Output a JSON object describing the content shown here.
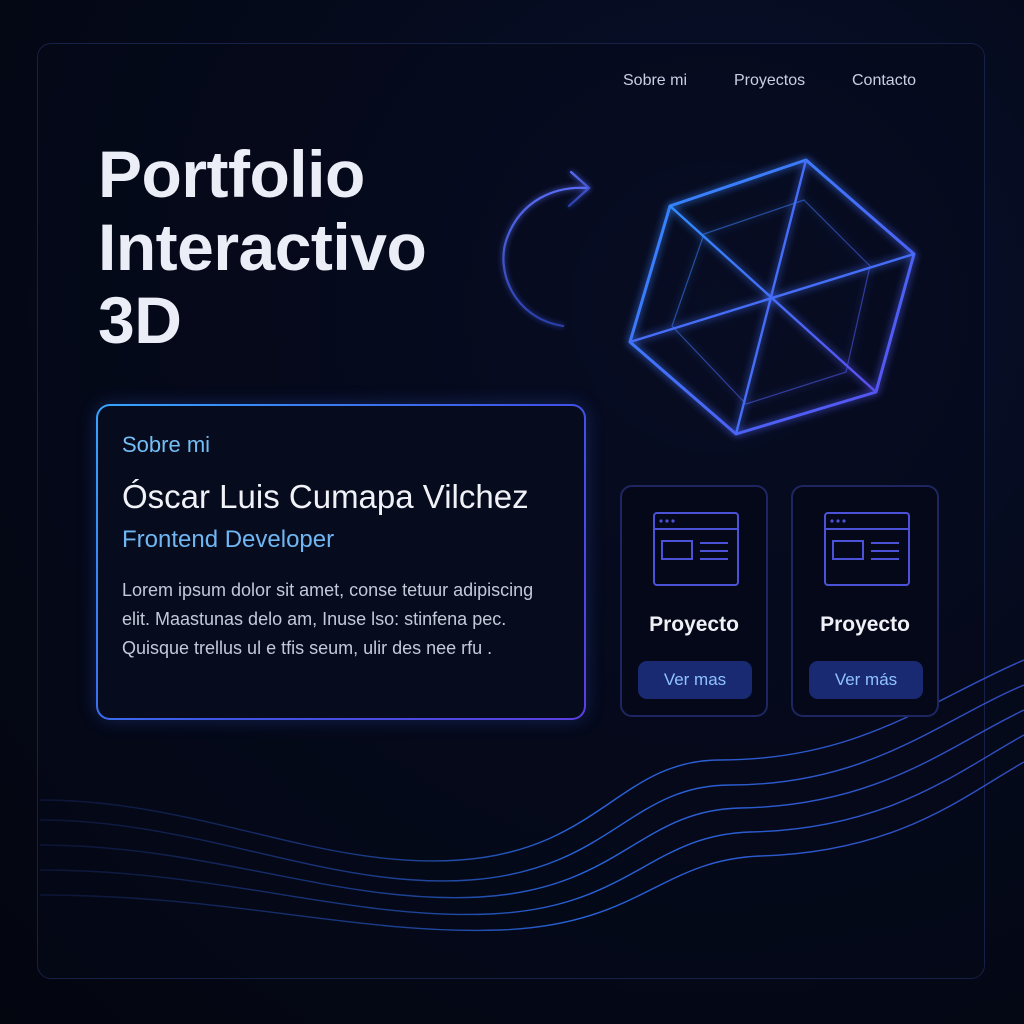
{
  "nav": {
    "items": [
      {
        "label": "Sobre mi"
      },
      {
        "label": "Proyectos"
      },
      {
        "label": "Contacto"
      }
    ]
  },
  "hero": {
    "title_lines": [
      "Portfolio",
      "Interactivo",
      "3D"
    ]
  },
  "about": {
    "heading": "Sobre mi",
    "name": "Óscar Luis Cumapa Vilchez",
    "role": "Frontend Developer",
    "body_lines": [
      "Lorem ipsum dolor sit amet, conse tetuur adipiscing",
      "elit. Maastunas delo am, Inuse lso: stinfena pec.",
      "Quisque trellus ul e tfis seum, ulir des nee rfu ."
    ]
  },
  "projects": [
    {
      "title": "Proyecto",
      "button_label": "Ver mas",
      "icon": "browser-window-icon"
    },
    {
      "title": "Proyecto",
      "button_label": "Ver más",
      "icon": "browser-window-icon"
    }
  ],
  "decor": {
    "hero_graphic": "wireframe-hexagon-icon",
    "rotate_graphic": "rotate-arrow-icon"
  },
  "colors": {
    "background": "#03060f",
    "accent_blue": "#36a6ff",
    "accent_violet": "#5b3fe0",
    "button_bg": "#1a2a72",
    "button_text": "#8fc2ff",
    "card_border": "#1d2660"
  }
}
